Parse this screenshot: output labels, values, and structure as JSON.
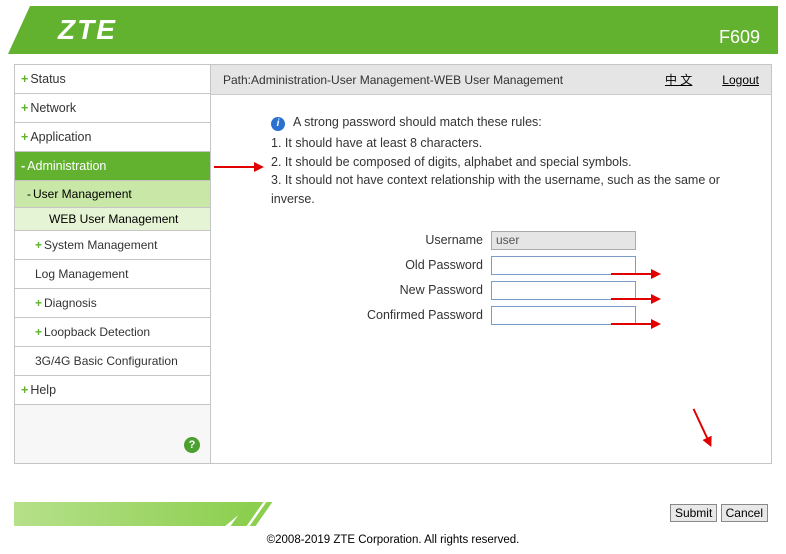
{
  "header": {
    "logo": "ZTE",
    "model": "F609"
  },
  "sidebar": {
    "items": [
      {
        "label": "Status",
        "type": "plus"
      },
      {
        "label": "Network",
        "type": "plus"
      },
      {
        "label": "Application",
        "type": "plus"
      },
      {
        "label": "Administration",
        "type": "active"
      },
      {
        "label": "User Management",
        "type": "sub"
      },
      {
        "label": "WEB User Management",
        "type": "subsub"
      },
      {
        "label": "System Management",
        "type": "plus-sub"
      },
      {
        "label": "Log Management",
        "type": "indent"
      },
      {
        "label": "Diagnosis",
        "type": "plus-sub"
      },
      {
        "label": "Loopback Detection",
        "type": "plus-sub"
      },
      {
        "label": "3G/4G Basic Configuration",
        "type": "indent"
      },
      {
        "label": "Help",
        "type": "plus"
      }
    ],
    "help_icon": "?"
  },
  "content": {
    "path": "Path:Administration-User Management-WEB User Management",
    "lang": "中 文",
    "logout": "Logout",
    "info_title": "A strong password should match these rules:",
    "info_rules": [
      "1. It should have at least 8 characters.",
      "2. It should be composed of digits, alphabet and special symbols.",
      "3. It should not have context relationship with the username, such as the same or inverse."
    ],
    "form": {
      "username_label": "Username",
      "username_value": "user",
      "old_pw_label": "Old Password",
      "new_pw_label": "New Password",
      "confirm_pw_label": "Confirmed Password"
    }
  },
  "buttons": {
    "submit": "Submit",
    "cancel": "Cancel"
  },
  "footer": {
    "copyright": "©2008-2019 ZTE Corporation. All rights reserved."
  }
}
